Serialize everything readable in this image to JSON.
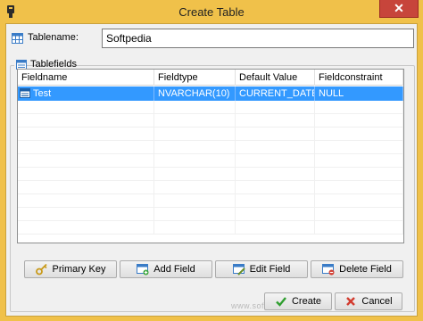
{
  "window": {
    "title": "Create Table",
    "close_glyph": "✕"
  },
  "tablename": {
    "label": "Tablename:",
    "value": "Softpedia"
  },
  "group": {
    "label": "Tablefields"
  },
  "grid": {
    "columns": [
      "Fieldname",
      "Fieldtype",
      "Default Value",
      "Fieldconstraint"
    ],
    "rows": [
      {
        "fieldname": "Test",
        "fieldtype": "NVARCHAR(10)",
        "default_value": "CURRENT_DATE",
        "fieldconstraint": "NULL",
        "selected": true
      }
    ]
  },
  "buttons": {
    "primary_key": "Primary Key",
    "add_field": "Add Field",
    "edit_field": "Edit Field",
    "delete_field": "Delete Field",
    "create": "Create",
    "cancel": "Cancel"
  },
  "watermark": "www.softpedia.com",
  "icons": [
    "app-icon",
    "table-icon",
    "list-icon",
    "row-icon",
    "key-icon",
    "add-field-icon",
    "edit-field-icon",
    "delete-field-icon",
    "check-icon",
    "cross-icon"
  ],
  "colors": {
    "titlebar": "#f0c14a",
    "close": "#c7453b",
    "selection": "#3399ff",
    "dialog": "#f0f0f0"
  }
}
